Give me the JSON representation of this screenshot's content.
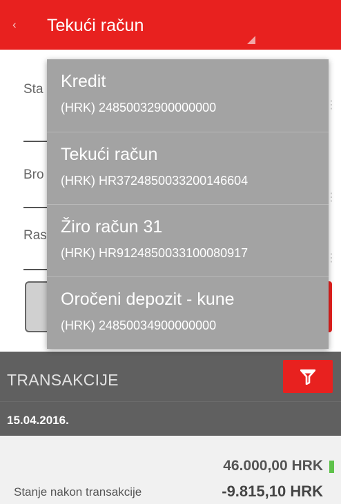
{
  "header": {
    "back_icon": "‹",
    "title": "Tekući račun"
  },
  "form": {
    "label_balance": "Sta",
    "label_number": "Bro",
    "label_available": "Ras"
  },
  "dropdown": {
    "items": [
      {
        "name": "Kredit",
        "number": "(HRK) 24850032900000000"
      },
      {
        "name": "Tekući račun",
        "number": "(HRK) HR3724850033200146604"
      },
      {
        "name": "Žiro račun 31",
        "number": "(HRK) HR9124850033100080917"
      },
      {
        "name": "Oročeni depozit - kune",
        "number": "(HRK) 24850034900000000"
      }
    ]
  },
  "transactions": {
    "title": "TRANSAKCIJE",
    "date": "15.04.2016.",
    "amount": "46.000,00 HRK",
    "balance_label": "Stanje nakon transakcije",
    "balance": "-9.815,10 HRK"
  },
  "colors": {
    "brand_red": "#e8211f",
    "dropdown_bg": "#a3a3a3",
    "section_bg": "#606060",
    "positive_indicator": "#5ec24a"
  },
  "icons": {
    "back": "chevron-left-icon",
    "filter": "filter-icon",
    "dropdown": "dropdown-triangle-icon"
  }
}
